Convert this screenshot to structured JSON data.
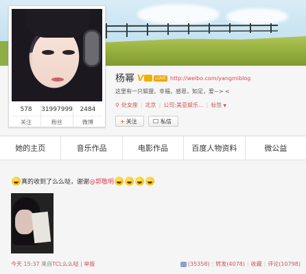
{
  "profile": {
    "name": "杨幂",
    "verified_mark": "V",
    "love_badge": "LOVE",
    "blog_url": "http://weibo.com/yangmiblog",
    "bio": "这里有一只狐狸，幸福，感恩，知足，爱~> <",
    "constellation": "处女座",
    "location": "北京",
    "company": "公司:美亚娱乐",
    "company_ellipsis": "...",
    "tags_label": "标签",
    "follow_button": "关注",
    "message_button": "私信"
  },
  "stats": [
    {
      "value": "578",
      "label": "关注"
    },
    {
      "value": "31997999",
      "label": "粉丝"
    },
    {
      "value": "2484",
      "label": "微博"
    }
  ],
  "tabs": [
    "她的主页",
    "音乐作品",
    "电影作品",
    "百度人物资料",
    "微公益"
  ],
  "post": {
    "text": "真的收到了么么哒，谢谢",
    "mention": "@郭敬明",
    "time": "今天 15:37",
    "source_prefix": "来自",
    "source": "TCL么么哒",
    "report": "举报",
    "likes": "(35358)",
    "repost": "转发(4078)",
    "favorite": "收藏",
    "comments": "评论(10798)"
  },
  "icons": {
    "location_pin": "location-pin-icon",
    "emoji": "smiley-emoji-icon"
  },
  "colors": {
    "link": "#dd4455",
    "accent": "#f7a600"
  }
}
